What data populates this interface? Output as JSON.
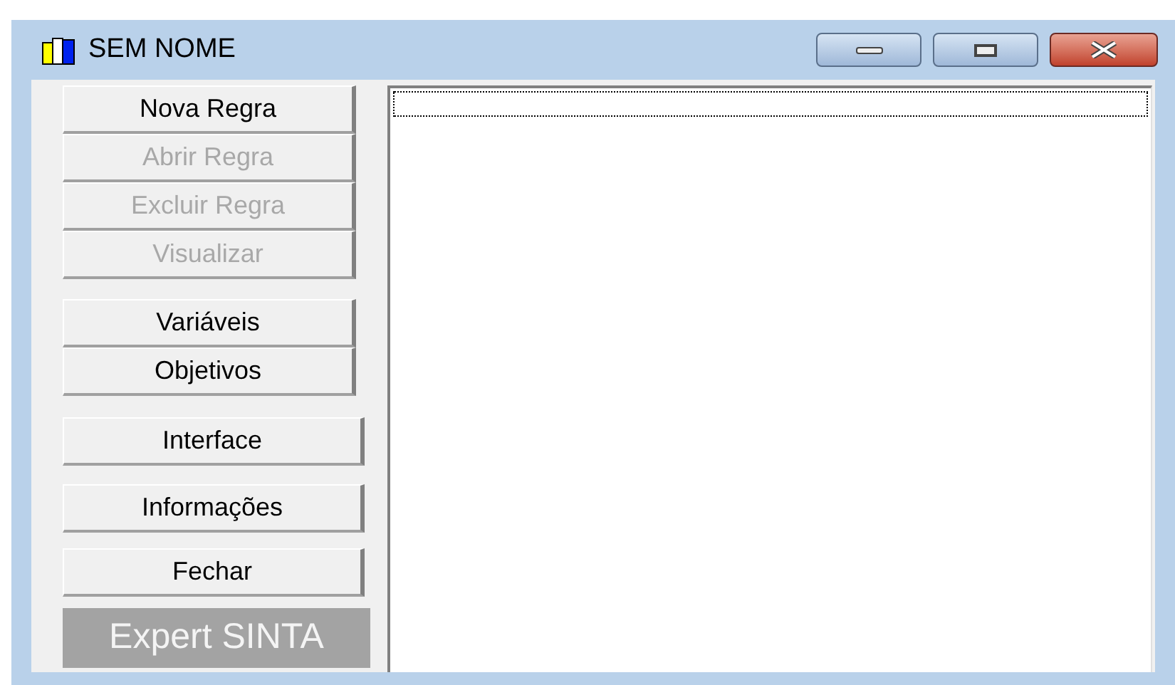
{
  "window": {
    "title": "SEM NOME"
  },
  "button_groups": [
    [
      {
        "label": "Nova Regra",
        "disabled": false
      },
      {
        "label": "Abrir Regra",
        "disabled": true
      },
      {
        "label": "Excluir Regra",
        "disabled": true
      },
      {
        "label": "Visualizar",
        "disabled": true
      }
    ],
    [
      {
        "label": "Variáveis",
        "disabled": false
      },
      {
        "label": "Objetivos",
        "disabled": false
      }
    ],
    [
      {
        "label": "Interface",
        "disabled": false
      }
    ],
    [
      {
        "label": "Informações",
        "disabled": false
      }
    ],
    [
      {
        "label": "Fechar",
        "disabled": false
      }
    ]
  ],
  "brand_label": "Expert SINTA"
}
